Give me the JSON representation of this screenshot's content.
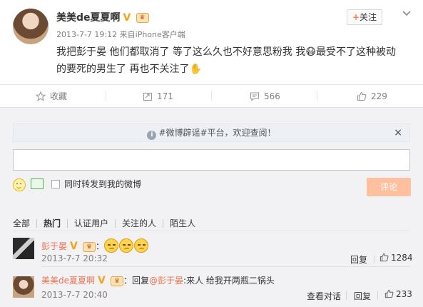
{
  "post": {
    "author": "美美de夏夏啊",
    "time": "2013-7-7 19:12",
    "source_prefix": "来自",
    "source": "iPhone客户端",
    "text": "我把彭于晏 他们都取消了 等了这么久也不好意思粉我 我😷最受不了这种被动的要死的男生了 再也不关注了✋",
    "follow_label": "关注",
    "follow_plus": "+"
  },
  "actions": {
    "favorite_label": "收藏",
    "repost_count": "171",
    "comment_count": "566",
    "like_count": "229"
  },
  "comment_box": {
    "notice": "#微博辟谣#平台，欢迎查阅！",
    "notice_close": "×",
    "input_value": "",
    "repost_option": "同时转发到我的微博",
    "submit_label": "评论"
  },
  "filters": {
    "tabs": [
      "全部",
      "热门",
      "认证用户",
      "关注的人",
      "陌生人"
    ],
    "active": "热门"
  },
  "comments": [
    {
      "author": "彭于晏",
      "text": "：",
      "time": "2013-7-7 20:32",
      "reply_label": "回复",
      "likes": "1284"
    },
    {
      "author": "美美de夏夏啊",
      "reply_prefix": "：回复",
      "mention": "@彭于晏",
      "text": ":来人 给我开两瓶二锅头",
      "time": "2013-7-7 20:40",
      "view_conversation": "查看对话",
      "reply_label": "回复",
      "likes": "233"
    }
  ],
  "colors": {
    "accent": "#eb7350",
    "submit_disabled": "#ffc09f",
    "panel_bg": "#f2f2f5"
  }
}
